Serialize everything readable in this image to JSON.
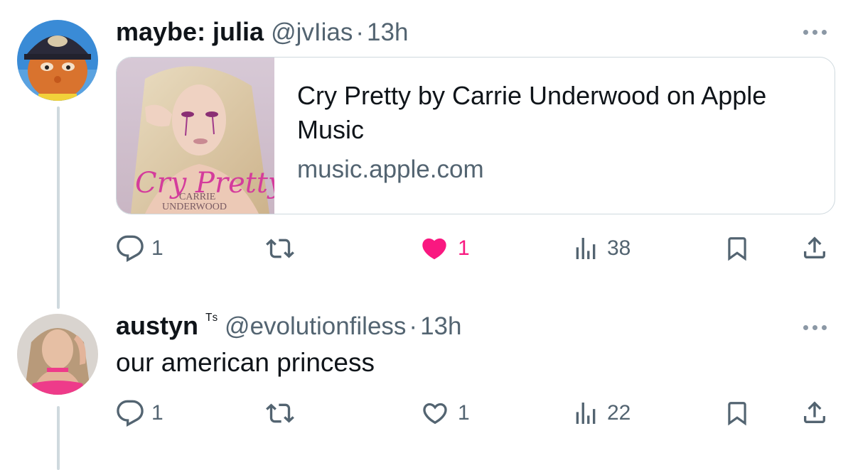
{
  "tweet1": {
    "name": "maybe: julia",
    "handle": "@jvIias",
    "separator": "·",
    "time": "13h",
    "card": {
      "title": "Cry Pretty by Carrie Underwood on Apple Music",
      "domain": "music.apple.com",
      "album_art_script": "Cry Pretty",
      "album_art_artist_line1": "CARRIE",
      "album_art_artist_line2": "UNDERWOOD"
    },
    "actions": {
      "replies": "1",
      "likes": "1",
      "views": "38",
      "liked": true
    }
  },
  "tweet2": {
    "name": "austyn",
    "name_badge": "ᵀˢ",
    "handle": "@evolutionfiless",
    "separator": "·",
    "time": "13h",
    "text": "our american princess",
    "actions": {
      "replies": "1",
      "likes": "1",
      "views": "22",
      "liked": false
    }
  },
  "icons": [
    "reply-icon",
    "retweet-icon",
    "like-icon",
    "views-icon",
    "bookmark-icon",
    "share-icon",
    "more-icon"
  ],
  "colors": {
    "text": "#0f1419",
    "secondary": "#536471",
    "like_active": "#f91880",
    "thread_line": "#cfd9de",
    "border": "#cfd9de"
  }
}
